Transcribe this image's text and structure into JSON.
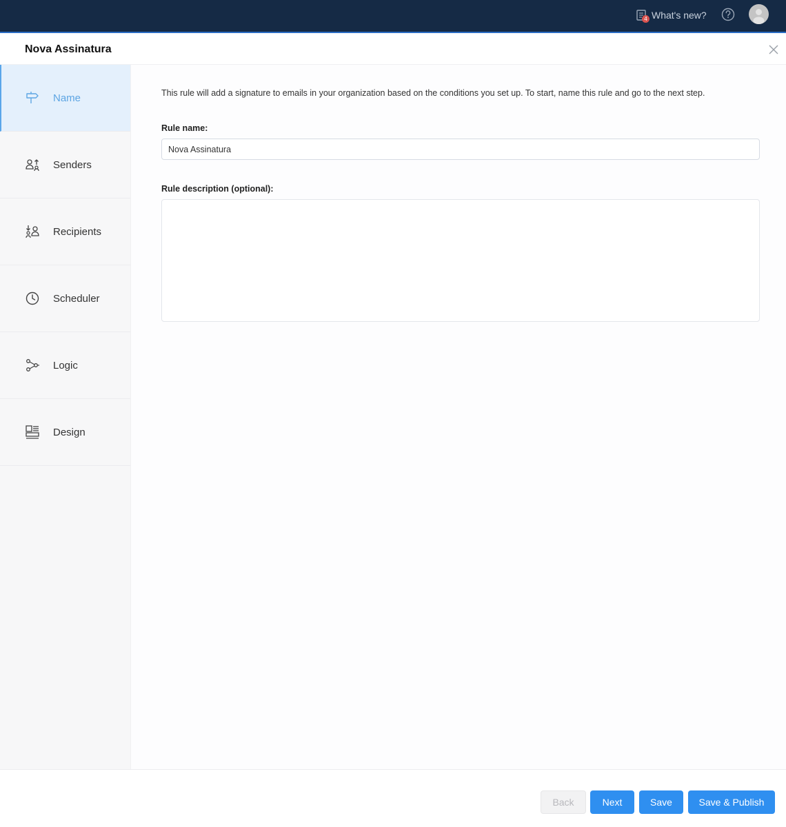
{
  "topbar": {
    "whats_new_label": "What's new?",
    "notification_count": "4",
    "help_icon": "help-circle-icon",
    "avatar_icon": "user-avatar"
  },
  "header": {
    "title": "Nova Assinatura",
    "close_icon": "close-icon"
  },
  "sidebar": {
    "items": [
      {
        "label": "Name",
        "icon": "signpost-icon",
        "active": true
      },
      {
        "label": "Senders",
        "icon": "senders-icon",
        "active": false
      },
      {
        "label": "Recipients",
        "icon": "recipients-icon",
        "active": false
      },
      {
        "label": "Scheduler",
        "icon": "clock-icon",
        "active": false
      },
      {
        "label": "Logic",
        "icon": "logic-flow-icon",
        "active": false
      },
      {
        "label": "Design",
        "icon": "design-layout-icon",
        "active": false
      }
    ]
  },
  "main": {
    "intro": "This rule will add a signature to emails in your organization based on the conditions you set up. To start, name this rule and go to the next step.",
    "rule_name_label": "Rule name:",
    "rule_name_value": "Nova Assinatura",
    "rule_description_label": "Rule description (optional):",
    "rule_description_value": ""
  },
  "footer": {
    "back_label": "Back",
    "next_label": "Next",
    "save_label": "Save",
    "save_publish_label": "Save & Publish"
  },
  "colors": {
    "topbar": "#152a45",
    "accent": "#2f8ff0",
    "active_nav_bg": "#e4f0fc",
    "active_nav_text": "#5da5e3"
  }
}
